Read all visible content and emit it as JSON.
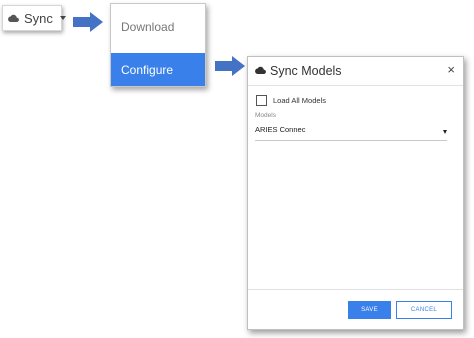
{
  "sync_button": {
    "label": "Sync",
    "icon": "cloud-icon"
  },
  "menu": {
    "items": [
      {
        "label": "Download",
        "selected": false
      },
      {
        "label": "Configure",
        "selected": true
      }
    ]
  },
  "dialog": {
    "title": "Sync Models",
    "close": "×",
    "load_all_label": "Load All Models",
    "load_all_checked": false,
    "models_label": "Models",
    "models_value": "ARIES Connec",
    "save_label": "SAVE",
    "cancel_label": "CANCEL"
  },
  "colors": {
    "accent": "#3a80ea",
    "arrow": "#4472c4"
  }
}
